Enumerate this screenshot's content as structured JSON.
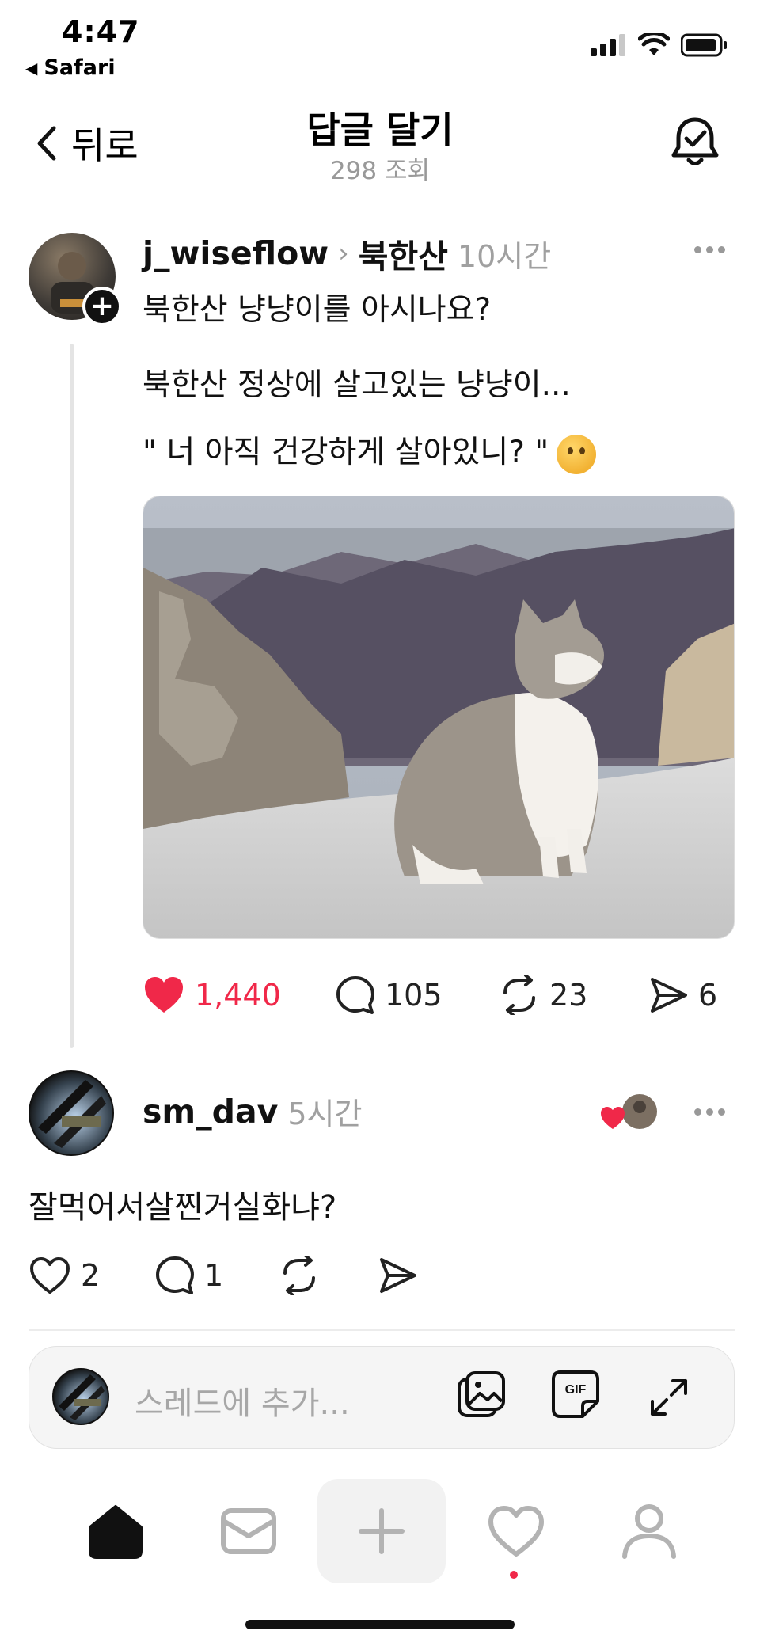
{
  "status_bar": {
    "time": "4:47",
    "back_app": "Safari"
  },
  "header": {
    "back_label": "뒤로",
    "title": "답글 달기",
    "views": "298 조회"
  },
  "post": {
    "username": "j_wiseflow",
    "community": "북한산",
    "time_ago": "10시간",
    "lines": [
      "북한산 냥냥이를 아시나요?",
      "북한산 정상에 살고있는 냥냥이...",
      "\" 너 아직 건강하게 살아있니? \""
    ],
    "likes": "1,440",
    "comments": "105",
    "reposts": "23",
    "shares": "6"
  },
  "reply": {
    "username": "sm_dav",
    "time_ago": "5시간",
    "text": "잘먹어서살찐거실화냐?",
    "likes": "2",
    "comments": "1"
  },
  "composer": {
    "placeholder": "스레드에 추가..."
  },
  "tabbar": {
    "items": [
      "home-icon",
      "mail-icon",
      "plus-icon",
      "heart-icon",
      "profile-icon"
    ]
  },
  "colors": {
    "like_red": "#f02849",
    "muted": "#999999"
  }
}
